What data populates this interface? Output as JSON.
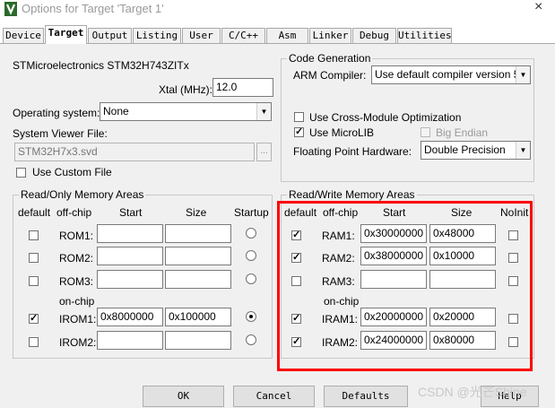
{
  "window": {
    "title": "Options for Target 'Target 1'",
    "close_symbol": "×"
  },
  "tabs": [
    "Device",
    "Target",
    "Output",
    "Listing",
    "User",
    "C/C++",
    "Asm",
    "Linker",
    "Debug",
    "Utilities"
  ],
  "active_tab": "Target",
  "device": "STMicroelectronics STM32H743ZITx",
  "xtal": {
    "label": "Xtal (MHz):",
    "value": "12.0"
  },
  "os": {
    "label": "Operating system:",
    "value": "None"
  },
  "svf": {
    "label": "System Viewer File:",
    "value": "STM32H7x3.svd",
    "browse": "..."
  },
  "custom_file": {
    "label": "Use Custom File",
    "checked": false
  },
  "codegen": {
    "title": "Code Generation",
    "compiler_label": "ARM Compiler:",
    "compiler_value": "Use default compiler version 5",
    "cross_module": {
      "label": "Use Cross-Module Optimization",
      "checked": false
    },
    "microlib": {
      "label": "Use MicroLIB",
      "checked": true
    },
    "big_endian": {
      "label": "Big Endian",
      "checked": false
    },
    "fp_label": "Floating Point Hardware:",
    "fp_value": "Double Precision"
  },
  "ro": {
    "title": "Read/Only Memory Areas",
    "headers": {
      "default": "default",
      "offchip": "off-chip",
      "start": "Start",
      "size": "Size",
      "startup": "Startup"
    },
    "onchip_label": "on-chip",
    "rows": [
      {
        "name": "ROM1:",
        "default": false,
        "start": "",
        "size": "",
        "startup": false
      },
      {
        "name": "ROM2:",
        "default": false,
        "start": "",
        "size": "",
        "startup": false
      },
      {
        "name": "ROM3:",
        "default": false,
        "start": "",
        "size": "",
        "startup": false
      },
      {
        "name": "IROM1:",
        "default": true,
        "start": "0x8000000",
        "size": "0x100000",
        "startup": true
      },
      {
        "name": "IROM2:",
        "default": false,
        "start": "",
        "size": "",
        "startup": false
      }
    ]
  },
  "rw": {
    "title": "Read/Write Memory Areas",
    "headers": {
      "default": "default",
      "offchip": "off-chip",
      "start": "Start",
      "size": "Size",
      "noinit": "NoInit"
    },
    "onchip_label": "on-chip",
    "rows": [
      {
        "name": "RAM1:",
        "default": true,
        "start": "0x30000000",
        "size": "0x48000",
        "noinit": false
      },
      {
        "name": "RAM2:",
        "default": true,
        "start": "0x38000000",
        "size": "0x10000",
        "noinit": false
      },
      {
        "name": "RAM3:",
        "default": false,
        "start": "",
        "size": "",
        "noinit": false
      },
      {
        "name": "IRAM1:",
        "default": true,
        "start": "0x20000000",
        "size": "0x20000",
        "noinit": false
      },
      {
        "name": "IRAM2:",
        "default": true,
        "start": "0x24000000",
        "size": "0x80000",
        "noinit": false
      }
    ]
  },
  "buttons": {
    "ok": "OK",
    "cancel": "Cancel",
    "defaults": "Defaults",
    "help": "Help"
  },
  "watermark": "CSDN @光芒Shine",
  "colors": {
    "highlight": "#ff0000",
    "dialog_bg": "#f0f0f0"
  }
}
